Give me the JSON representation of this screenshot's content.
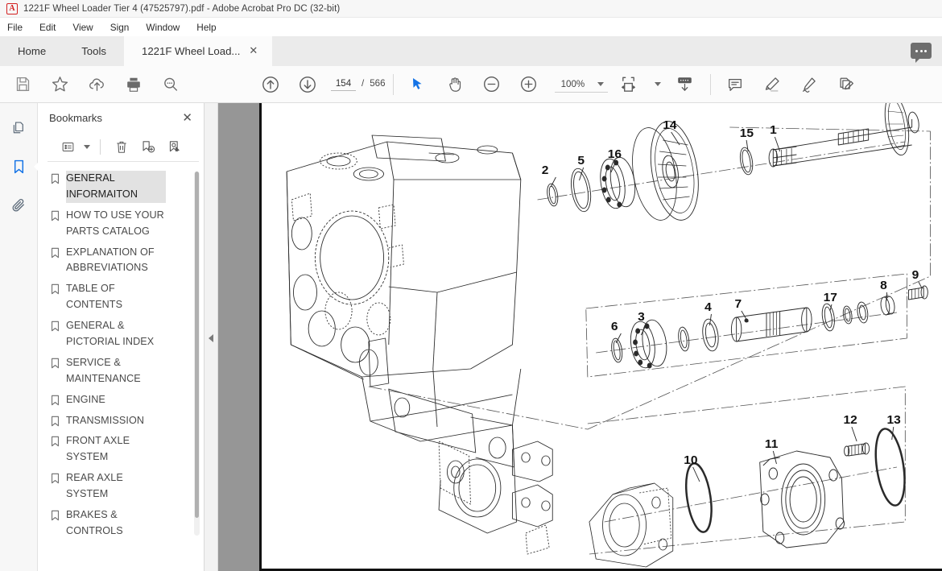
{
  "window": {
    "title": "1221F Wheel Loader Tier 4 (47525797).pdf - Adobe Acrobat Pro DC (32-bit)",
    "logo_glyph": "A"
  },
  "menu": {
    "items": [
      "File",
      "Edit",
      "View",
      "Sign",
      "Window",
      "Help"
    ]
  },
  "tabs": {
    "home": "Home",
    "tools": "Tools",
    "document": "1221F Wheel Load...",
    "close_glyph": "✕"
  },
  "toolbar": {
    "icons": [
      "save-icon",
      "star-icon",
      "upload-cloud-icon",
      "print-icon",
      "search-icon"
    ],
    "prev_page": "previous-page-icon",
    "next_page": "next-page-icon",
    "page_current": "154",
    "page_separator": "/",
    "page_total": "566",
    "select_tool": "cursor-select-icon",
    "hand_tool": "hand-tool-icon",
    "zoom_out": "zoom-out-icon",
    "zoom_in": "zoom-in-icon",
    "zoom_level": "100%",
    "fit_page": "fit-page-icon",
    "scroll_mode": "page-scroll-icon",
    "comment": "comment-icon",
    "highlight": "highlight-icon",
    "sign": "sign-pen-icon",
    "edit_pdf": "edit-pdf-icon"
  },
  "rail": {
    "thumbnails": "page-thumbnails-icon",
    "bookmarks": "bookmarks-icon",
    "attachments": "attachments-icon"
  },
  "bookmarks_panel": {
    "title": "Bookmarks",
    "close_glyph": "✕",
    "tools": [
      "bookmark-options-icon",
      "delete-bookmark-icon",
      "new-bookmark-icon",
      "edit-bookmark-icon"
    ],
    "items": [
      {
        "label": "GENERAL INFORMAITON",
        "selected": true
      },
      {
        "label": "HOW TO USE YOUR PARTS CATALOG",
        "selected": false
      },
      {
        "label": "EXPLANATION OF ABBREVIATIONS",
        "selected": false
      },
      {
        "label": "TABLE OF CONTENTS",
        "selected": false
      },
      {
        "label": "GENERAL & PICTORIAL INDEX",
        "selected": false
      },
      {
        "label": "SERVICE & MAINTENANCE",
        "selected": false
      },
      {
        "label": "ENGINE",
        "selected": false
      },
      {
        "label": "TRANSMISSION",
        "selected": false
      },
      {
        "label": "FRONT AXLE SYSTEM",
        "selected": false
      },
      {
        "label": "REAR AXLE SYSTEM",
        "selected": false
      },
      {
        "label": "BRAKES & CONTROLS",
        "selected": false
      }
    ]
  },
  "document_page": {
    "callouts": {
      "top_assembly": [
        "2",
        "5",
        "16",
        "14",
        "15",
        "1"
      ],
      "middle_assembly": [
        "6",
        "3",
        "4",
        "7",
        "17",
        "8",
        "9"
      ],
      "bottom_assembly": [
        "10",
        "11",
        "12",
        "13"
      ]
    },
    "c1": "1",
    "c2": "2",
    "c3": "3",
    "c4": "4",
    "c5": "5",
    "c6": "6",
    "c7": "7",
    "c8": "8",
    "c9": "9",
    "c10": "10",
    "c11": "11",
    "c12": "12",
    "c13": "13",
    "c14": "14",
    "c15": "15",
    "c16": "16",
    "c17": "17"
  },
  "colors": {
    "accent": "#1473e6",
    "title_bar": "#f7f7f7",
    "tab_active": "#fbfbfb",
    "doc_background": "#969696",
    "selection": "#e2e2e2"
  }
}
